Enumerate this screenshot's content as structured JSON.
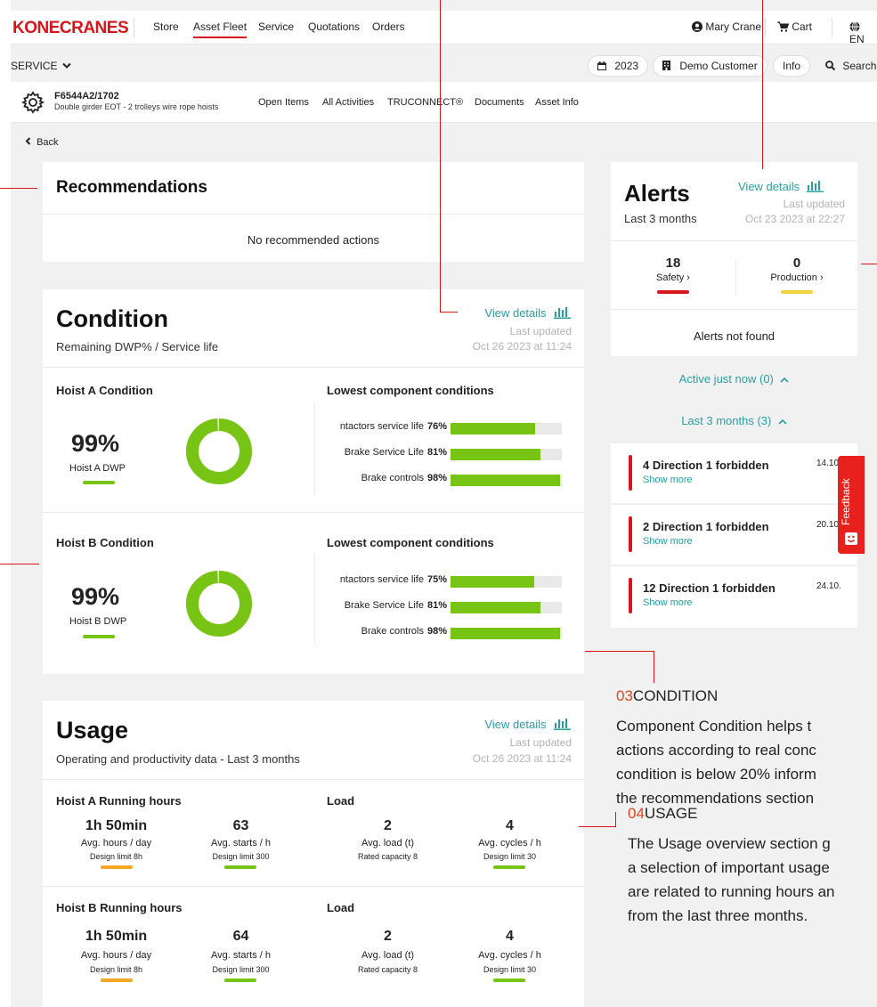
{
  "header": {
    "logo": "KONECRANES",
    "nav": [
      "Store",
      "Asset Fleet",
      "Service",
      "Quotations",
      "Orders"
    ],
    "active_nav": "Asset Fleet",
    "user": "Mary Crane",
    "cart": "Cart",
    "language": "EN"
  },
  "service_bar": {
    "label": "SERVICE",
    "year": "2023",
    "customer": "Demo Customer",
    "info": "Info",
    "search": "Search"
  },
  "asset": {
    "id": "F6544A2/1702",
    "description": "Double girder EOT - 2 trolleys wire rope hoists",
    "tabs": [
      "Open Items",
      "All Activities",
      "TRUCONNECT®",
      "Documents",
      "Asset Info"
    ]
  },
  "back_label": "Back",
  "recommendations": {
    "title": "Recommendations",
    "empty": "No recommended actions"
  },
  "condition": {
    "title": "Condition",
    "subtitle": "Remaining DWP% / Service life",
    "view_details": "View details",
    "last_updated_label": "Last updated",
    "last_updated": "Oct 26 2023 at 11:24",
    "hoists": [
      {
        "title": "Hoist A Condition",
        "pct_label": "99%",
        "pct": 99,
        "dwp_label": "Hoist A DWP",
        "components_title": "Lowest component conditions",
        "components": [
          {
            "label": "ntactors service life",
            "value_label": "76%",
            "value": 76
          },
          {
            "label": "Brake Service Life",
            "value_label": "81%",
            "value": 81
          },
          {
            "label": "Brake controls",
            "value_label": "98%",
            "value": 98
          }
        ]
      },
      {
        "title": "Hoist B Condition",
        "pct_label": "99%",
        "pct": 99,
        "dwp_label": "Hoist B DWP",
        "components_title": "Lowest component conditions",
        "components": [
          {
            "label": "ntactors service life",
            "value_label": "75%",
            "value": 75
          },
          {
            "label": "Brake Service Life",
            "value_label": "81%",
            "value": 81
          },
          {
            "label": "Brake controls",
            "value_label": "98%",
            "value": 98
          }
        ]
      }
    ]
  },
  "usage": {
    "title": "Usage",
    "subtitle": "Operating and productivity data - Last 3 months",
    "view_details": "View details",
    "last_updated_label": "Last updated",
    "last_updated": "Oct 26 2023 at 11:24",
    "rows": [
      {
        "title": "Hoist A Running hours",
        "load_title": "Load",
        "metrics": [
          {
            "value": "1h 50min",
            "label": "Avg. hours / day",
            "limit": "Design limit 8h"
          },
          {
            "value": "63",
            "label": "Avg. starts / h",
            "limit": "Design limit 300"
          },
          {
            "value": "2",
            "label": "Avg. load (t)",
            "limit": "Rated capacity 8"
          },
          {
            "value": "4",
            "label": "Avg. cycles / h",
            "limit": "Design limit 30"
          }
        ]
      },
      {
        "title": "Hoist B Running hours",
        "load_title": "Load",
        "metrics": [
          {
            "value": "1h 50min",
            "label": "Avg. hours / day",
            "limit": "Design limit 8h"
          },
          {
            "value": "64",
            "label": "Avg. starts / h",
            "limit": "Design limit 300"
          },
          {
            "value": "2",
            "label": "Avg. load (t)",
            "limit": "Rated capacity 8"
          },
          {
            "value": "4",
            "label": "Avg. cycles / h",
            "limit": "Design limit 30"
          }
        ]
      }
    ]
  },
  "alerts": {
    "title": "Alerts",
    "subtitle": "Last 3 months",
    "view_details": "View details",
    "last_updated_label": "Last updated",
    "last_updated": "Oct 23 2023 at 22:27",
    "safety_count": "18",
    "safety_label": "Safety",
    "production_count": "0",
    "production_label": "Production",
    "empty": "Alerts not found",
    "active_label": "Active just now (0)",
    "last3_label": "Last 3 months (3)",
    "items": [
      {
        "title": "4 Direction 1 forbidden",
        "more": "Show more",
        "date": "14.10."
      },
      {
        "title": "2 Direction 1 forbidden",
        "more": "Show more",
        "date": "20.10."
      },
      {
        "title": "12 Direction 1 forbidden",
        "more": "Show more",
        "date": "24.10."
      }
    ]
  },
  "feedback_label": "Feedback",
  "annotations": [
    {
      "number": "03",
      "heading": "CONDITION",
      "lines": [
        "Component Condition helps t",
        "actions according to real conc",
        "condition is below 20% inform",
        "the recommendations section"
      ]
    },
    {
      "number": "04",
      "heading": "USAGE",
      "lines": [
        "The Usage overview section g",
        "a selection of important usage",
        "are related to running hours an",
        "from the last three months."
      ]
    }
  ],
  "colors": {
    "brand_red": "#d9151c",
    "accent_teal": "#2a9fa3",
    "green": "#78c415",
    "orange": "#f5a623",
    "yellow": "#f2d13b",
    "annotation_orange": "#e8431b"
  }
}
